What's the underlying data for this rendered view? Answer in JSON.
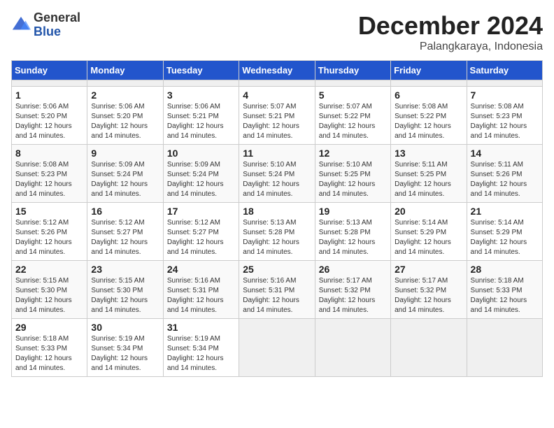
{
  "header": {
    "logo_general": "General",
    "logo_blue": "Blue",
    "month_title": "December 2024",
    "subtitle": "Palangkaraya, Indonesia"
  },
  "calendar": {
    "days_of_week": [
      "Sunday",
      "Monday",
      "Tuesday",
      "Wednesday",
      "Thursday",
      "Friday",
      "Saturday"
    ],
    "weeks": [
      [
        {
          "day": "",
          "info": ""
        },
        {
          "day": "",
          "info": ""
        },
        {
          "day": "",
          "info": ""
        },
        {
          "day": "",
          "info": ""
        },
        {
          "day": "",
          "info": ""
        },
        {
          "day": "",
          "info": ""
        },
        {
          "day": "",
          "info": ""
        }
      ],
      [
        {
          "day": "1",
          "info": "Sunrise: 5:06 AM\nSunset: 5:20 PM\nDaylight: 12 hours and 14 minutes."
        },
        {
          "day": "2",
          "info": "Sunrise: 5:06 AM\nSunset: 5:20 PM\nDaylight: 12 hours and 14 minutes."
        },
        {
          "day": "3",
          "info": "Sunrise: 5:06 AM\nSunset: 5:21 PM\nDaylight: 12 hours and 14 minutes."
        },
        {
          "day": "4",
          "info": "Sunrise: 5:07 AM\nSunset: 5:21 PM\nDaylight: 12 hours and 14 minutes."
        },
        {
          "day": "5",
          "info": "Sunrise: 5:07 AM\nSunset: 5:22 PM\nDaylight: 12 hours and 14 minutes."
        },
        {
          "day": "6",
          "info": "Sunrise: 5:08 AM\nSunset: 5:22 PM\nDaylight: 12 hours and 14 minutes."
        },
        {
          "day": "7",
          "info": "Sunrise: 5:08 AM\nSunset: 5:23 PM\nDaylight: 12 hours and 14 minutes."
        }
      ],
      [
        {
          "day": "8",
          "info": "Sunrise: 5:08 AM\nSunset: 5:23 PM\nDaylight: 12 hours and 14 minutes."
        },
        {
          "day": "9",
          "info": "Sunrise: 5:09 AM\nSunset: 5:24 PM\nDaylight: 12 hours and 14 minutes."
        },
        {
          "day": "10",
          "info": "Sunrise: 5:09 AM\nSunset: 5:24 PM\nDaylight: 12 hours and 14 minutes."
        },
        {
          "day": "11",
          "info": "Sunrise: 5:10 AM\nSunset: 5:24 PM\nDaylight: 12 hours and 14 minutes."
        },
        {
          "day": "12",
          "info": "Sunrise: 5:10 AM\nSunset: 5:25 PM\nDaylight: 12 hours and 14 minutes."
        },
        {
          "day": "13",
          "info": "Sunrise: 5:11 AM\nSunset: 5:25 PM\nDaylight: 12 hours and 14 minutes."
        },
        {
          "day": "14",
          "info": "Sunrise: 5:11 AM\nSunset: 5:26 PM\nDaylight: 12 hours and 14 minutes."
        }
      ],
      [
        {
          "day": "15",
          "info": "Sunrise: 5:12 AM\nSunset: 5:26 PM\nDaylight: 12 hours and 14 minutes."
        },
        {
          "day": "16",
          "info": "Sunrise: 5:12 AM\nSunset: 5:27 PM\nDaylight: 12 hours and 14 minutes."
        },
        {
          "day": "17",
          "info": "Sunrise: 5:12 AM\nSunset: 5:27 PM\nDaylight: 12 hours and 14 minutes."
        },
        {
          "day": "18",
          "info": "Sunrise: 5:13 AM\nSunset: 5:28 PM\nDaylight: 12 hours and 14 minutes."
        },
        {
          "day": "19",
          "info": "Sunrise: 5:13 AM\nSunset: 5:28 PM\nDaylight: 12 hours and 14 minutes."
        },
        {
          "day": "20",
          "info": "Sunrise: 5:14 AM\nSunset: 5:29 PM\nDaylight: 12 hours and 14 minutes."
        },
        {
          "day": "21",
          "info": "Sunrise: 5:14 AM\nSunset: 5:29 PM\nDaylight: 12 hours and 14 minutes."
        }
      ],
      [
        {
          "day": "22",
          "info": "Sunrise: 5:15 AM\nSunset: 5:30 PM\nDaylight: 12 hours and 14 minutes."
        },
        {
          "day": "23",
          "info": "Sunrise: 5:15 AM\nSunset: 5:30 PM\nDaylight: 12 hours and 14 minutes."
        },
        {
          "day": "24",
          "info": "Sunrise: 5:16 AM\nSunset: 5:31 PM\nDaylight: 12 hours and 14 minutes."
        },
        {
          "day": "25",
          "info": "Sunrise: 5:16 AM\nSunset: 5:31 PM\nDaylight: 12 hours and 14 minutes."
        },
        {
          "day": "26",
          "info": "Sunrise: 5:17 AM\nSunset: 5:32 PM\nDaylight: 12 hours and 14 minutes."
        },
        {
          "day": "27",
          "info": "Sunrise: 5:17 AM\nSunset: 5:32 PM\nDaylight: 12 hours and 14 minutes."
        },
        {
          "day": "28",
          "info": "Sunrise: 5:18 AM\nSunset: 5:33 PM\nDaylight: 12 hours and 14 minutes."
        }
      ],
      [
        {
          "day": "29",
          "info": "Sunrise: 5:18 AM\nSunset: 5:33 PM\nDaylight: 12 hours and 14 minutes."
        },
        {
          "day": "30",
          "info": "Sunrise: 5:19 AM\nSunset: 5:34 PM\nDaylight: 12 hours and 14 minutes."
        },
        {
          "day": "31",
          "info": "Sunrise: 5:19 AM\nSunset: 5:34 PM\nDaylight: 12 hours and 14 minutes."
        },
        {
          "day": "",
          "info": ""
        },
        {
          "day": "",
          "info": ""
        },
        {
          "day": "",
          "info": ""
        },
        {
          "day": "",
          "info": ""
        }
      ]
    ]
  }
}
